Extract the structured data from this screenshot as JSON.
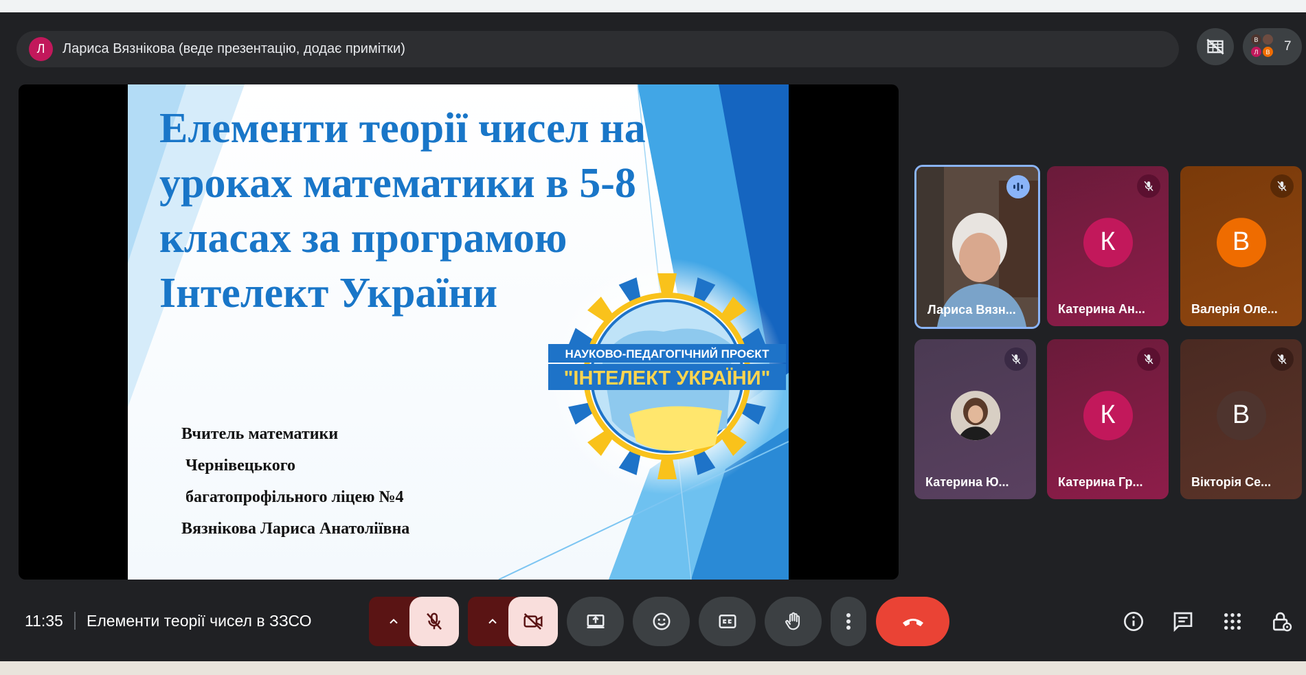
{
  "presenter_banner": {
    "avatar_letter": "Л",
    "text": "Лариса Вязнікова (веде презентацію, додає примітки)"
  },
  "people": {
    "count": "7",
    "avatar_letters": [
      "В",
      "Л",
      "В"
    ]
  },
  "slide": {
    "title": "Елементи теорії чисел на уроках математики в 5-8 класах за програмою Інтелект України",
    "emblem_line1": "НАУКОВО-ПЕДАГОГІЧНИЙ ПРОЄКТ",
    "emblem_line2": "\"ІНТЕЛЕКТ УКРАЇНИ\"",
    "author_lines": [
      "Вчитель математики",
      " Чернівецького",
      " багатопрофільного ліцею №4",
      "Вязнікова Лариса Анатоліївна"
    ]
  },
  "participants": [
    {
      "name": "Лариса Вязн...",
      "speaking": true,
      "video": true,
      "letter": ""
    },
    {
      "name": "Катерина Ан...",
      "speaking": false,
      "letter": "К",
      "color": "#c2185b"
    },
    {
      "name": "Валерія Оле...",
      "speaking": false,
      "letter": "В",
      "color": "#ef6c00"
    },
    {
      "name": "Катерина Ю...",
      "speaking": false,
      "letter": "",
      "photo": true
    },
    {
      "name": "Катерина Гр...",
      "speaking": false,
      "letter": "К",
      "color": "#c2185b"
    },
    {
      "name": "Вікторія Се...",
      "speaking": false,
      "letter": "В",
      "color": "#4e342e"
    }
  ],
  "bottom_bar": {
    "time": "11:35",
    "meeting_title": "Елементи теорії чисел в ЗЗСО"
  },
  "colors": {
    "background": "#202124",
    "end_call": "#ea4335",
    "slide_title": "#1976c8"
  },
  "icons": [
    "hide-tiles-icon",
    "mic-off-icon",
    "camera-off-icon",
    "present-icon",
    "emoji-icon",
    "captions-icon",
    "raise-hand-icon",
    "more-options-icon",
    "end-call-icon",
    "info-icon",
    "chat-icon",
    "activities-icon",
    "host-controls-icon"
  ]
}
